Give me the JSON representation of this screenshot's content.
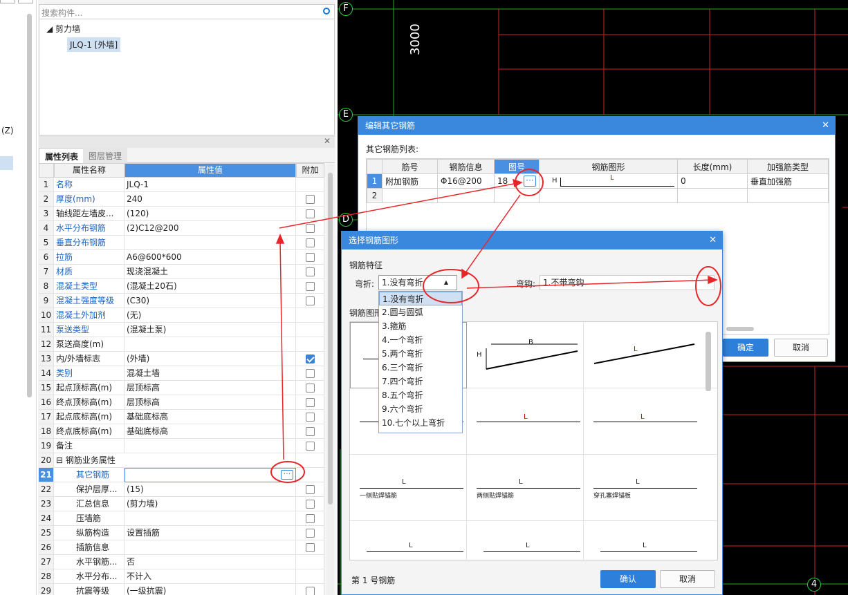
{
  "left_strip": {
    "label": "(Z)"
  },
  "component_panel": {
    "search_placeholder": "搜索构件...",
    "tree_root": "剪力墙",
    "tree_child": "JLQ-1 [外墙]"
  },
  "prop_tabs": [
    "属性列表",
    "图层管理"
  ],
  "prop_columns": [
    "属性名称",
    "属性值",
    "附加"
  ],
  "prop_rows": [
    {
      "n": "1",
      "name": "名称",
      "value": "JLQ-1",
      "blue": true,
      "cb": "none"
    },
    {
      "n": "2",
      "name": "厚度(mm)",
      "value": "240",
      "blue": true,
      "cb": "off"
    },
    {
      "n": "3",
      "name": "轴线距左墙皮...",
      "value": "(120)",
      "blue": false,
      "cb": "off"
    },
    {
      "n": "4",
      "name": "水平分布钢筋",
      "value": "(2)C12@200",
      "blue": true,
      "cb": "off"
    },
    {
      "n": "5",
      "name": "垂直分布钢筋",
      "value": "",
      "blue": true,
      "cb": "off"
    },
    {
      "n": "6",
      "name": "拉筋",
      "value": "A6@600*600",
      "blue": true,
      "cb": "off"
    },
    {
      "n": "7",
      "name": "材质",
      "value": "现浇混凝土",
      "blue": true,
      "cb": "off"
    },
    {
      "n": "8",
      "name": "混凝土类型",
      "value": "(混凝土20石)",
      "blue": true,
      "cb": "off"
    },
    {
      "n": "9",
      "name": "混凝土强度等级",
      "value": "(C30)",
      "blue": true,
      "cb": "off"
    },
    {
      "n": "10",
      "name": "混凝土外加剂",
      "value": "(无)",
      "blue": true,
      "cb": "none"
    },
    {
      "n": "11",
      "name": "泵送类型",
      "value": "(混凝土泵)",
      "blue": true,
      "cb": "none"
    },
    {
      "n": "12",
      "name": "泵送高度(m)",
      "value": "",
      "blue": false,
      "cb": "none"
    },
    {
      "n": "13",
      "name": "内/外墙标志",
      "value": "(外墙)",
      "blue": false,
      "cb": "on"
    },
    {
      "n": "14",
      "name": "类别",
      "value": "混凝土墙",
      "blue": true,
      "cb": "off"
    },
    {
      "n": "15",
      "name": "起点顶标高(m)",
      "value": "层顶标高",
      "blue": false,
      "cb": "off"
    },
    {
      "n": "16",
      "name": "终点顶标高(m)",
      "value": "层顶标高",
      "blue": false,
      "cb": "off"
    },
    {
      "n": "17",
      "name": "起点底标高(m)",
      "value": "基础底标高",
      "blue": false,
      "cb": "off"
    },
    {
      "n": "18",
      "name": "终点底标高(m)",
      "value": "基础底标高",
      "blue": false,
      "cb": "off"
    },
    {
      "n": "19",
      "name": "备注",
      "value": "",
      "blue": false,
      "cb": "off"
    },
    {
      "n": "20",
      "name": "钢筋业务属性",
      "value": "",
      "blue": false,
      "cb": "none",
      "group": true
    },
    {
      "n": "21",
      "name": "其它钢筋",
      "value": "",
      "blue": true,
      "cb": "none",
      "sub": true,
      "active": true
    },
    {
      "n": "22",
      "name": "保护层厚...",
      "value": "(15)",
      "blue": false,
      "cb": "off",
      "sub": true
    },
    {
      "n": "23",
      "name": "汇总信息",
      "value": "(剪力墙)",
      "blue": false,
      "cb": "off",
      "sub": true
    },
    {
      "n": "24",
      "name": "压墙筋",
      "value": "",
      "blue": false,
      "cb": "off",
      "sub": true
    },
    {
      "n": "25",
      "name": "纵筋构造",
      "value": "设置插筋",
      "blue": false,
      "cb": "off",
      "sub": true
    },
    {
      "n": "26",
      "name": "插筋信息",
      "value": "",
      "blue": false,
      "cb": "off",
      "sub": true
    },
    {
      "n": "27",
      "name": "水平钢筋...",
      "value": "否",
      "blue": false,
      "cb": "none",
      "sub": true
    },
    {
      "n": "28",
      "name": "水平分布...",
      "value": "不计入",
      "blue": false,
      "cb": "none",
      "sub": true
    },
    {
      "n": "29",
      "name": "抗震等级",
      "value": "(一级抗震)",
      "blue": false,
      "cb": "off",
      "sub": true
    }
  ],
  "cad": {
    "labels": [
      "F",
      "E",
      "D",
      "4"
    ],
    "dimension": "3000"
  },
  "edit_dialog": {
    "title": "编辑其它钢筋",
    "list_label": "其它钢筋列表:",
    "columns": [
      "筋号",
      "钢筋信息",
      "图号",
      "钢筋图形",
      "长度(mm)",
      "加强筋类型"
    ],
    "row1": {
      "n": "1",
      "name": "附加钢筋",
      "info": "Φ16@200",
      "fig": "18",
      "shape_h": "H",
      "shape_l": "L",
      "length": "0",
      "type": "垂直加强筋"
    },
    "row2": {
      "n": "2"
    },
    "ok": "确定",
    "cancel": "取消"
  },
  "select_dialog": {
    "title": "选择钢筋图形",
    "feature_label": "钢筋特征",
    "bend_label": "弯折:",
    "bend_value": "1.没有弯折",
    "hook_label": "弯钩:",
    "hook_value": "1.不带弯钩",
    "shape_label": "钢筋图形",
    "options": [
      "1.没有弯折",
      "2.圆与圆弧",
      "3.箍筋",
      "4.一个弯折",
      "5.两个弯折",
      "6.三个弯折",
      "7.四个弯折",
      "8.五个弯折",
      "9.六个弯折",
      "10.七个以上弯折"
    ],
    "cell_labels": {
      "L": "L",
      "B": "B",
      "H": "H"
    },
    "anchor_labels": [
      "一侧贴焊锚筋",
      "两侧贴焊锚筋",
      "穿孔塞焊锚板"
    ],
    "footer": "第 1 号钢筋",
    "ok": "确认",
    "cancel": "取消"
  },
  "colors": {
    "accent": "#3a88de",
    "annotation": "#e8262a",
    "grid_red": "#d4202a",
    "grid_green": "#22b02a"
  }
}
